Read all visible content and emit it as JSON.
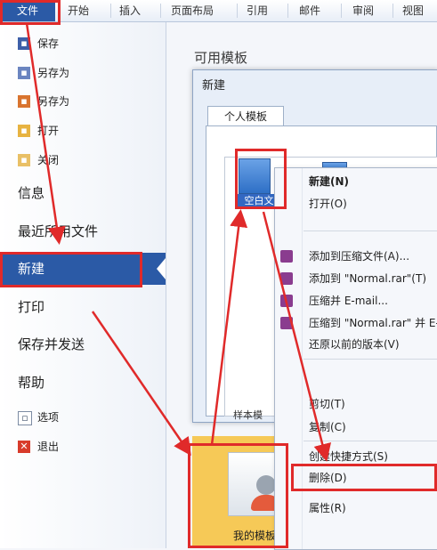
{
  "ribbon": {
    "file_tab": "文件",
    "tabs": [
      "开始",
      "插入",
      "页面布局",
      "引用",
      "邮件",
      "审阅",
      "视图"
    ]
  },
  "backstage": {
    "save": "保存",
    "save_as": "另存为",
    "save_as_other": "另存为 ",
    "open": "打开",
    "close": "关闭",
    "info": "信息",
    "recent": "最近所用文件",
    "new": "新建",
    "print": "打印",
    "save_send": "保存并发送",
    "help": "帮助",
    "options": "选项",
    "exit": "退出"
  },
  "main": {
    "available_templates": "可用模板",
    "dialog_title": "新建",
    "dialog_tab": "个人模板",
    "blank_doc_label": "空白文",
    "obscured_label": "样本模",
    "my_templates_label": "我的模板"
  },
  "context_menu": {
    "new": "新建(N)",
    "open": "打开(O)",
    "add_archive": "添加到压缩文件(A)...",
    "add_normal_rar": "添加到 \"Normal.rar\"(T)",
    "compress_email": "压缩并 E-mail...",
    "compress_normal_email": "压缩到 \"Normal.rar\" 并 E-mail",
    "restore": "还原以前的版本(V)",
    "cut": "剪切(T)",
    "copy": "复制(C)",
    "create_shortcut": "创建快捷方式(S)",
    "delete": "删除(D)",
    "properties": "属性(R)"
  },
  "colors": {
    "accent_blue": "#2b5aa6",
    "annotation_red": "#e02a2a",
    "template_tile": "#f6c957"
  }
}
